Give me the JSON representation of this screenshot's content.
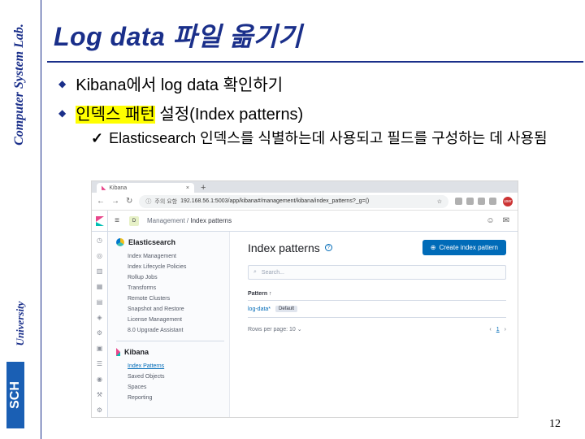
{
  "sidebar_brand": {
    "lab": "Computer System Lab.",
    "university": "University",
    "logo_text": "SCH"
  },
  "slide": {
    "title": "Log data 파일 옮기기",
    "bullets": [
      {
        "mark": "◆",
        "text": "Kibana에서 log data 확인하기"
      },
      {
        "mark": "◆",
        "highlight": "인덱스 패턴",
        "text": " 설정(Index patterns)"
      }
    ],
    "sub_bullet": {
      "mark": "✓",
      "text": "Elasticsearch 인덱스를 식별하는데 사용되고 필드를 구성하는 데 사용됨"
    },
    "page_number": "12"
  },
  "screenshot": {
    "browser": {
      "tab_title": "Kibana",
      "new_tab": "+",
      "url_warning": "주의 요함",
      "url": "192.168.56.1:5003/app/kibana#/management/kibana/index_patterns?_g=()",
      "avatar": "user"
    },
    "kibana": {
      "space_letter": "D",
      "breadcrumb": [
        "Management",
        "Index patterns"
      ],
      "sidenav": {
        "elasticsearch_title": "Elasticsearch",
        "elasticsearch_items": [
          "Index Management",
          "Index Lifecycle Policies",
          "Rollup Jobs",
          "Transforms",
          "Remote Clusters",
          "Snapshot and Restore",
          "License Management",
          "8.0 Upgrade Assistant"
        ],
        "kibana_title": "Kibana",
        "kibana_items": [
          "Index Patterns",
          "Saved Objects",
          "Spaces",
          "Reporting"
        ],
        "active_item": "Index Patterns"
      },
      "main": {
        "heading": "Index patterns",
        "create_button": "Create index pattern",
        "search_placeholder": "Search...",
        "column_header": "Pattern ↑",
        "rows": [
          {
            "pattern": "log-data*",
            "badge": "Default"
          }
        ],
        "rows_per_page": "Rows per page: 10",
        "current_page": "1"
      }
    }
  },
  "colors": {
    "accent": "#1a2f8a",
    "highlight": "#ffff00",
    "kibana_blue": "#006bb8"
  }
}
